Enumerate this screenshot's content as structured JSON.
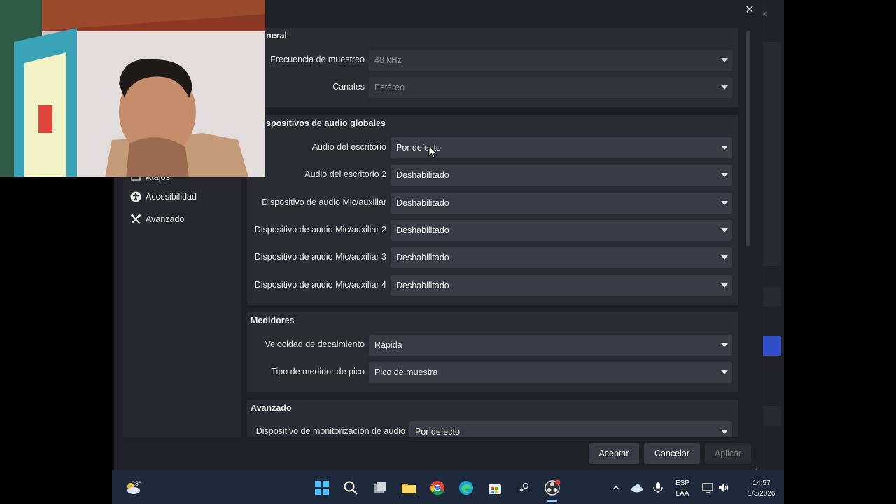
{
  "dialog": {
    "close_symbol": "✕",
    "sections": {
      "general": {
        "title": "neral",
        "rows": [
          {
            "label": "Frecuencia de muestreo",
            "value": "48 kHz"
          },
          {
            "label": "Canales",
            "value": "Estéreo"
          }
        ]
      },
      "global_audio": {
        "title": "spositivos de audio globales",
        "rows": [
          {
            "label": "Audio del escritorio",
            "value": "Por defecto"
          },
          {
            "label": "Audio del escritorio 2",
            "value": "Deshabilitado"
          },
          {
            "label": "Dispositivo de audio Mic/auxiliar",
            "value": "Deshabilitado"
          },
          {
            "label": "Dispositivo de audio Mic/auxiliar 2",
            "value": "Deshabilitado"
          },
          {
            "label": "Dispositivo de audio Mic/auxiliar 3",
            "value": "Deshabilitado"
          },
          {
            "label": "Dispositivo de audio Mic/auxiliar 4",
            "value": "Deshabilitado"
          }
        ]
      },
      "meters": {
        "title": "Medidores",
        "rows": [
          {
            "label": "Velocidad de decaimiento",
            "value": "Rápida"
          },
          {
            "label": "Tipo de medidor de pico",
            "value": "Pico de muestra"
          }
        ]
      },
      "advanced": {
        "title": "Avanzado",
        "rows": [
          {
            "label": "Dispositivo de monitorización de audio",
            "value": "Por defecto"
          }
        ]
      }
    },
    "sidebar": {
      "items": [
        {
          "label": "Atajos",
          "icon": "keyboard-icon"
        },
        {
          "label": "Accesibilidad",
          "icon": "accessibility-icon"
        },
        {
          "label": "Avanzado",
          "icon": "tools-icon"
        }
      ]
    },
    "buttons": {
      "accept": "Aceptar",
      "cancel": "Cancelar",
      "apply": "Aplicar"
    }
  },
  "taskbar": {
    "weather_temp": "28°",
    "lang_line1": "ESP",
    "lang_line2": "LAA",
    "time": "14:57",
    "date": "1/3/2026"
  },
  "colors": {
    "dialog_bg": "#202127",
    "panel_bg": "#2b2c33",
    "combo_bg": "#3a3b44",
    "taskbar_bg": "#1e2a3b"
  }
}
